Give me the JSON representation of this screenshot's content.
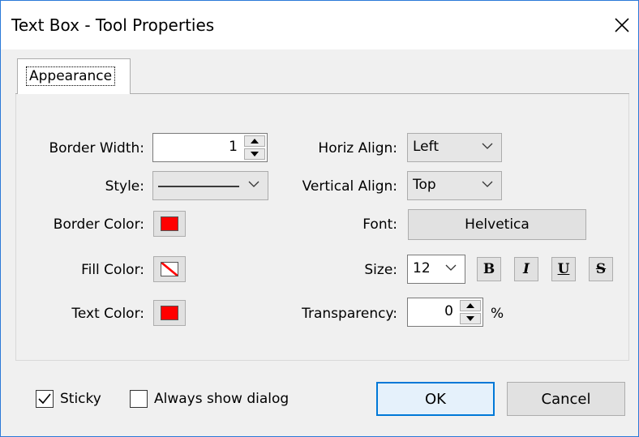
{
  "window": {
    "title": "Text Box - Tool Properties"
  },
  "tabs": [
    {
      "label": "Appearance"
    }
  ],
  "left": {
    "border_width_label": "Border Width:",
    "border_width_value": "1",
    "style_label": "Style:",
    "border_color_label": "Border Color:",
    "fill_color_label": "Fill Color:",
    "text_color_label": "Text Color:"
  },
  "right": {
    "horiz_align_label": "Horiz Align:",
    "horiz_align_value": "Left",
    "vertical_align_label": "Vertical Align:",
    "vertical_align_value": "Top",
    "font_label": "Font:",
    "font_value": "Helvetica",
    "size_label": "Size:",
    "size_value": "12",
    "style_buttons": [
      "B",
      "I",
      "U",
      "S"
    ],
    "transparency_label": "Transparency:",
    "transparency_value": "0",
    "transparency_unit": "%"
  },
  "footer": {
    "sticky_label": "Sticky",
    "sticky_checked": true,
    "always_show_label": "Always show dialog",
    "always_show_checked": false,
    "ok_label": "OK",
    "cancel_label": "Cancel"
  },
  "colors": {
    "border_color": "#ff0000",
    "fill_color": "none",
    "text_color": "#ff0000",
    "accent": "#0078d7"
  }
}
